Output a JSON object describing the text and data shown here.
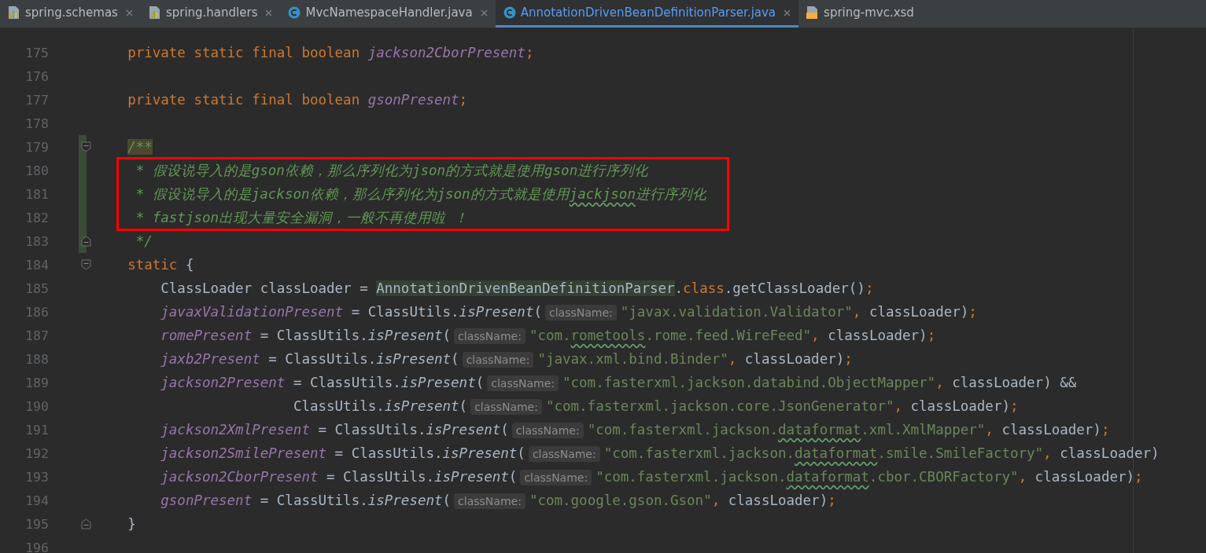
{
  "tabs": [
    {
      "label": "spring.schemas",
      "kind": "bars",
      "selected": false,
      "closable": true
    },
    {
      "label": "spring.handlers",
      "kind": "bars",
      "selected": false,
      "closable": true
    },
    {
      "label": "MvcNamespaceHandler.java",
      "kind": "class",
      "selected": false,
      "closable": true
    },
    {
      "label": "AnnotationDrivenBeanDefinitionParser.java",
      "kind": "class",
      "selected": true,
      "closable": true
    },
    {
      "label": "spring-mvc.xsd",
      "kind": "xsd",
      "selected": false,
      "closable": false
    }
  ],
  "editor": {
    "lines": [
      {
        "number": "175",
        "kind": "code",
        "changed": false,
        "boxed": false,
        "tokens": [
          {
            "kind": "kw",
            "t": "    private static final boolean "
          },
          {
            "kind": "field",
            "t": "jackson2CborPresent"
          },
          {
            "kind": "punct",
            "t": ";"
          }
        ]
      },
      {
        "number": "176",
        "kind": "code",
        "changed": false,
        "boxed": false
      },
      {
        "number": "177",
        "kind": "code",
        "changed": false,
        "boxed": false,
        "tokens": [
          {
            "kind": "kw",
            "t": "    private static final boolean "
          },
          {
            "kind": "field",
            "t": "gsonPresent"
          },
          {
            "kind": "punct",
            "t": ";"
          }
        ]
      },
      {
        "number": "178",
        "kind": "code",
        "changed": false,
        "boxed": false
      },
      {
        "number": "179",
        "kind": "fold-start",
        "changed": true,
        "boxed": false,
        "tokens": [
          {
            "kind": "comment-hl",
            "t": "    /**"
          }
        ]
      },
      {
        "number": "180",
        "kind": "code",
        "changed": true,
        "boxed": true,
        "tokens": [
          {
            "kind": "comment",
            "t": "     * 假设说导入的是gson依赖，那么序列化为json的方式就是使用gson进行序列化"
          }
        ]
      },
      {
        "number": "181",
        "kind": "code",
        "changed": true,
        "boxed": true,
        "tokens": [
          {
            "kind": "comment",
            "t": "     * 假设说导入的是jackson依赖，那么序列化为json的方式就是使用"
          },
          {
            "kind": "comment-typo",
            "t": "jackjson"
          },
          {
            "kind": "comment",
            "t": "进行序列化"
          }
        ]
      },
      {
        "number": "182",
        "kind": "code",
        "changed": true,
        "boxed": true,
        "tokens": [
          {
            "kind": "comment",
            "t": "     * fastjson出现大量安全漏洞，一般不再使用啦 ！"
          }
        ]
      },
      {
        "number": "183",
        "kind": "fold-end",
        "changed": true,
        "boxed": false,
        "tokens": [
          {
            "kind": "comment",
            "t": "     */"
          }
        ]
      },
      {
        "number": "184",
        "kind": "fold-start",
        "changed": false,
        "boxed": false,
        "tokens": [
          {
            "kind": "kw",
            "t": "    static "
          },
          {
            "kind": "plain",
            "t": "{"
          }
        ]
      },
      {
        "number": "185",
        "kind": "code",
        "changed": false,
        "boxed": false,
        "tokens": [
          {
            "kind": "plain",
            "t": "        ClassLoader classLoader = "
          },
          {
            "kind": "cls",
            "t": "AnnotationDrivenBeanDefinitionParser"
          },
          {
            "kind": "plain",
            "t": "."
          },
          {
            "kind": "kw",
            "t": "class"
          },
          {
            "kind": "plain",
            "t": ".getClassLoader()"
          },
          {
            "kind": "punct",
            "t": ";"
          }
        ]
      },
      {
        "number": "186",
        "kind": "code",
        "changed": false,
        "boxed": false,
        "tokens": [
          {
            "kind": "field",
            "t": "        javaxValidationPresent"
          },
          {
            "kind": "plain",
            "t": " = ClassUtils."
          },
          {
            "kind": "method",
            "t": "isPresent"
          },
          {
            "kind": "plain",
            "t": "("
          },
          {
            "kind": "hint",
            "t": "className:"
          },
          {
            "kind": "str",
            "t": "\"javax.validation.Validator\""
          },
          {
            "kind": "punct",
            "t": ","
          },
          {
            "kind": "plain",
            "t": " classLoader)"
          },
          {
            "kind": "punct",
            "t": ";"
          }
        ]
      },
      {
        "number": "187",
        "kind": "code",
        "changed": false,
        "boxed": false,
        "tokens": [
          {
            "kind": "field",
            "t": "        romePresent"
          },
          {
            "kind": "plain",
            "t": " = ClassUtils."
          },
          {
            "kind": "method",
            "t": "isPresent"
          },
          {
            "kind": "plain",
            "t": "("
          },
          {
            "kind": "hint",
            "t": "className:"
          },
          {
            "kind": "str",
            "t": "\"com."
          },
          {
            "kind": "str-typo",
            "t": "rometools"
          },
          {
            "kind": "str",
            "t": ".rome.feed.WireFeed\""
          },
          {
            "kind": "punct",
            "t": ","
          },
          {
            "kind": "plain",
            "t": " classLoader)"
          },
          {
            "kind": "punct",
            "t": ";"
          }
        ]
      },
      {
        "number": "188",
        "kind": "code",
        "changed": false,
        "boxed": false,
        "tokens": [
          {
            "kind": "field",
            "t": "        jaxb2Present"
          },
          {
            "kind": "plain",
            "t": " = ClassUtils."
          },
          {
            "kind": "method",
            "t": "isPresent"
          },
          {
            "kind": "plain",
            "t": "("
          },
          {
            "kind": "hint",
            "t": "className:"
          },
          {
            "kind": "str",
            "t": "\"javax.xml.bind.Binder\""
          },
          {
            "kind": "punct",
            "t": ","
          },
          {
            "kind": "plain",
            "t": " classLoader)"
          },
          {
            "kind": "punct",
            "t": ";"
          }
        ]
      },
      {
        "number": "189",
        "kind": "code",
        "changed": false,
        "boxed": false,
        "tokens": [
          {
            "kind": "field",
            "t": "        jackson2Present"
          },
          {
            "kind": "plain",
            "t": " = ClassUtils."
          },
          {
            "kind": "method",
            "t": "isPresent"
          },
          {
            "kind": "plain",
            "t": "("
          },
          {
            "kind": "hint",
            "t": "className:"
          },
          {
            "kind": "str",
            "t": "\"com.fasterxml.jackson.databind.ObjectMapper\""
          },
          {
            "kind": "punct",
            "t": ","
          },
          {
            "kind": "plain",
            "t": " classLoader) &&"
          }
        ]
      },
      {
        "number": "190",
        "kind": "code",
        "changed": false,
        "boxed": false,
        "tokens": [
          {
            "kind": "plain",
            "t": "                        ClassUtils."
          },
          {
            "kind": "method",
            "t": "isPresent"
          },
          {
            "kind": "plain",
            "t": "("
          },
          {
            "kind": "hint",
            "t": "className:"
          },
          {
            "kind": "str",
            "t": "\"com.fasterxml.jackson.core.JsonGenerator\""
          },
          {
            "kind": "punct",
            "t": ","
          },
          {
            "kind": "plain",
            "t": " classLoader)"
          },
          {
            "kind": "punct",
            "t": ";"
          }
        ]
      },
      {
        "number": "191",
        "kind": "code",
        "changed": false,
        "boxed": false,
        "tokens": [
          {
            "kind": "field",
            "t": "        jackson2XmlPresent"
          },
          {
            "kind": "plain",
            "t": " = ClassUtils."
          },
          {
            "kind": "method",
            "t": "isPresent"
          },
          {
            "kind": "plain",
            "t": "("
          },
          {
            "kind": "hint",
            "t": "className:"
          },
          {
            "kind": "str",
            "t": "\"com.fasterxml.jackson."
          },
          {
            "kind": "str-typo",
            "t": "dataformat"
          },
          {
            "kind": "str",
            "t": ".xml.XmlMapper\""
          },
          {
            "kind": "punct",
            "t": ","
          },
          {
            "kind": "plain",
            "t": " classLoader)"
          },
          {
            "kind": "punct",
            "t": ";"
          }
        ]
      },
      {
        "number": "192",
        "kind": "code",
        "changed": false,
        "boxed": false,
        "tokens": [
          {
            "kind": "field",
            "t": "        jackson2SmilePresent"
          },
          {
            "kind": "plain",
            "t": " = ClassUtils."
          },
          {
            "kind": "method",
            "t": "isPresent"
          },
          {
            "kind": "plain",
            "t": "("
          },
          {
            "kind": "hint",
            "t": "className:"
          },
          {
            "kind": "str",
            "t": "\"com.fasterxml.jackson."
          },
          {
            "kind": "str-typo",
            "t": "dataformat"
          },
          {
            "kind": "str",
            "t": ".smile.SmileFactory\""
          },
          {
            "kind": "punct",
            "t": ","
          },
          {
            "kind": "plain",
            "t": " classLoader)"
          }
        ]
      },
      {
        "number": "193",
        "kind": "code",
        "changed": false,
        "boxed": false,
        "tokens": [
          {
            "kind": "field",
            "t": "        jackson2CborPresent"
          },
          {
            "kind": "plain",
            "t": " = ClassUtils."
          },
          {
            "kind": "method",
            "t": "isPresent"
          },
          {
            "kind": "plain",
            "t": "("
          },
          {
            "kind": "hint",
            "t": "className:"
          },
          {
            "kind": "str",
            "t": "\"com.fasterxml.jackson."
          },
          {
            "kind": "str-typo",
            "t": "dataformat"
          },
          {
            "kind": "str",
            "t": ".cbor.CBORFactory\""
          },
          {
            "kind": "punct",
            "t": ","
          },
          {
            "kind": "plain",
            "t": " classLoader)"
          },
          {
            "kind": "punct",
            "t": ";"
          }
        ]
      },
      {
        "number": "194",
        "kind": "code",
        "changed": false,
        "boxed": false,
        "tokens": [
          {
            "kind": "field",
            "t": "        gsonPresent"
          },
          {
            "kind": "plain",
            "t": " = ClassUtils."
          },
          {
            "kind": "method",
            "t": "isPresent"
          },
          {
            "kind": "plain",
            "t": "("
          },
          {
            "kind": "hint",
            "t": "className:"
          },
          {
            "kind": "str",
            "t": "\"com.google.gson.Gson\""
          },
          {
            "kind": "punct",
            "t": ","
          },
          {
            "kind": "plain",
            "t": " classLoader)"
          },
          {
            "kind": "punct",
            "t": ";"
          }
        ]
      },
      {
        "number": "195",
        "kind": "fold-end",
        "changed": false,
        "boxed": false,
        "tokens": [
          {
            "kind": "plain",
            "t": "    }"
          }
        ]
      },
      {
        "number": "196",
        "kind": "code",
        "changed": false,
        "boxed": false
      }
    ]
  }
}
